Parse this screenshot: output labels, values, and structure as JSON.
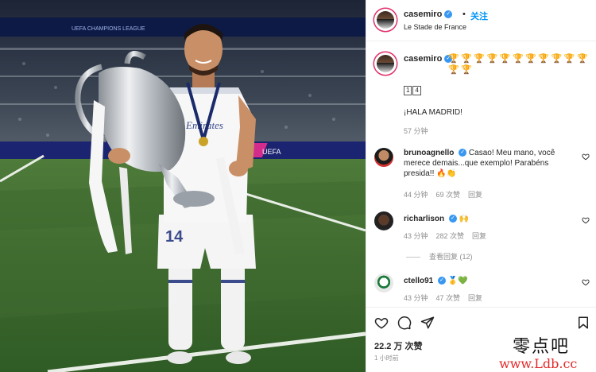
{
  "header": {
    "username": "casemiro",
    "dot": "•",
    "follow_label": "关注",
    "location": "Le Stade de France"
  },
  "photo": {
    "banner_text": "UEFA CHAMPIONS LEAGUE",
    "board_text": "UEFA",
    "jersey_sponsor": "Emirates",
    "shorts_number": "14"
  },
  "caption": {
    "username": "casemiro",
    "trophy_count": 13,
    "boxed_digits": [
      "1",
      "4"
    ],
    "text": "¡HALA MADRID!",
    "time": "57 分钟"
  },
  "comments": [
    {
      "username": "brunoagnello",
      "text": "Casao! Meu mano, você merece demais...que exemplo! Parabéns presida!! 🔥👏",
      "time": "44 分钟",
      "likes": "69 次赞",
      "reply": "回复"
    },
    {
      "username": "richarlison",
      "text": "🙌",
      "time": "43 分钟",
      "likes": "282 次赞",
      "reply": "回复",
      "view_replies": "查看回复 (12)"
    },
    {
      "username": "ctello91",
      "text": "🥇💚",
      "time": "43 分钟",
      "likes": "47 次赞",
      "reply": "回复"
    }
  ],
  "actions": {
    "likes": "22.2 万 次赞",
    "time": "1 小时前"
  },
  "watermark": {
    "chinese": "零点吧",
    "url": "www.Ldb.cc"
  },
  "colors": {
    "link_blue": "#0095f6",
    "verified_blue": "#3897f0",
    "muted": "#8e8e8e",
    "trophy_gold": "#c9a227",
    "watermark_red": "#e52828"
  },
  "icons": {
    "verified": "verified-badge-icon",
    "heart": "heart-icon",
    "comment": "comment-bubble-icon",
    "share": "paper-plane-icon",
    "save": "bookmark-icon",
    "trophy": "trophy-icon"
  }
}
